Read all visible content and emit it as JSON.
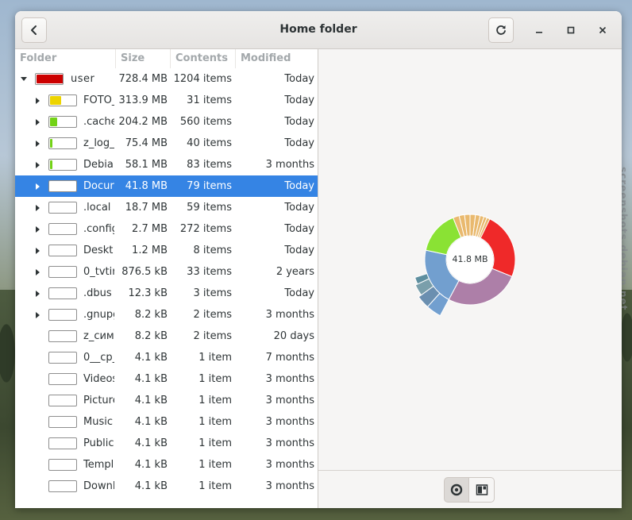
{
  "window": {
    "title": "Home folder",
    "back_icon": "back-arrow-icon",
    "reload_icon": "reload-icon"
  },
  "columns": [
    "Folder",
    "Size",
    "Contents",
    "Modified"
  ],
  "rows": [
    {
      "name": "user",
      "size": "728.4 MB",
      "items": "1204 items",
      "modified": "Today",
      "level": 0,
      "expanded": true,
      "fill": 1.0,
      "color": "#cc0000"
    },
    {
      "name": "FOTO_",
      "size": "313.9 MB",
      "items": "31 items",
      "modified": "Today",
      "level": 1,
      "expander": true,
      "fill": 0.43,
      "color": "#edd400"
    },
    {
      "name": ".cache",
      "size": "204.2 MB",
      "items": "560 items",
      "modified": "Today",
      "level": 1,
      "expander": true,
      "fill": 0.28,
      "color": "#73d216"
    },
    {
      "name": "z_log_",
      "size": "75.4 MB",
      "items": "40 items",
      "modified": "Today",
      "level": 1,
      "expander": true,
      "fill": 0.1,
      "color": "#73d216"
    },
    {
      "name": "Debia",
      "size": "58.1 MB",
      "items": "83 items",
      "modified": "3 months",
      "level": 1,
      "expander": true,
      "fill": 0.08,
      "color": "#73d216"
    },
    {
      "name": "Docur",
      "size": "41.8 MB",
      "items": "79 items",
      "modified": "Today",
      "level": 1,
      "expander": true,
      "fill": 0.06,
      "color": "#3584e4",
      "selected": true
    },
    {
      "name": ".local",
      "size": "18.7 MB",
      "items": "59 items",
      "modified": "Today",
      "level": 1,
      "expander": true,
      "fill": 0.0,
      "color": "#ffffff"
    },
    {
      "name": ".config",
      "size": "2.7 MB",
      "items": "272 items",
      "modified": "Today",
      "level": 1,
      "expander": true,
      "fill": 0.0,
      "color": "#ffffff"
    },
    {
      "name": "Deskt",
      "size": "1.2 MB",
      "items": "8 items",
      "modified": "Today",
      "level": 1,
      "expander": true,
      "fill": 0.0,
      "color": "#ffffff"
    },
    {
      "name": "0_tvtir",
      "size": "876.5 kB",
      "items": "33 items",
      "modified": "2 years",
      "level": 1,
      "expander": true,
      "fill": 0.0,
      "color": "#ffffff"
    },
    {
      "name": ".dbus",
      "size": "12.3 kB",
      "items": "3 items",
      "modified": "Today",
      "level": 1,
      "expander": true,
      "fill": 0.0,
      "color": "#ffffff"
    },
    {
      "name": ".gnupg",
      "size": "8.2 kB",
      "items": "2 items",
      "modified": "3 months",
      "level": 1,
      "expander": true,
      "fill": 0.0,
      "color": "#ffffff"
    },
    {
      "name": "z_сим",
      "size": "8.2 kB",
      "items": "2 items",
      "modified": "20 days",
      "level": 1,
      "expander": false,
      "fill": 0.0,
      "color": "#ffffff"
    },
    {
      "name": "0__cp_",
      "size": "4.1 kB",
      "items": "1 item",
      "modified": "7 months",
      "level": 1,
      "expander": false,
      "fill": 0.0,
      "color": "#ffffff"
    },
    {
      "name": "Videos",
      "size": "4.1 kB",
      "items": "1 item",
      "modified": "3 months",
      "level": 1,
      "expander": false,
      "fill": 0.0,
      "color": "#ffffff"
    },
    {
      "name": "Picture",
      "size": "4.1 kB",
      "items": "1 item",
      "modified": "3 months",
      "level": 1,
      "expander": false,
      "fill": 0.0,
      "color": "#ffffff"
    },
    {
      "name": "Music",
      "size": "4.1 kB",
      "items": "1 item",
      "modified": "3 months",
      "level": 1,
      "expander": false,
      "fill": 0.0,
      "color": "#ffffff"
    },
    {
      "name": "Public",
      "size": "4.1 kB",
      "items": "1 item",
      "modified": "3 months",
      "level": 1,
      "expander": false,
      "fill": 0.0,
      "color": "#ffffff"
    },
    {
      "name": "Templ",
      "size": "4.1 kB",
      "items": "1 item",
      "modified": "3 months",
      "level": 1,
      "expander": false,
      "fill": 0.0,
      "color": "#ffffff"
    },
    {
      "name": "Downl",
      "size": "4.1 kB",
      "items": "1 item",
      "modified": "3 months",
      "level": 1,
      "expander": false,
      "fill": 0.0,
      "color": "#ffffff"
    }
  ],
  "chart": {
    "center_label": "41.8 MB",
    "view_buttons": [
      {
        "name": "rings-chart-icon",
        "active": true
      },
      {
        "name": "treemap-chart-icon",
        "active": false
      }
    ]
  },
  "watermark": "screenshots.debian.net"
}
